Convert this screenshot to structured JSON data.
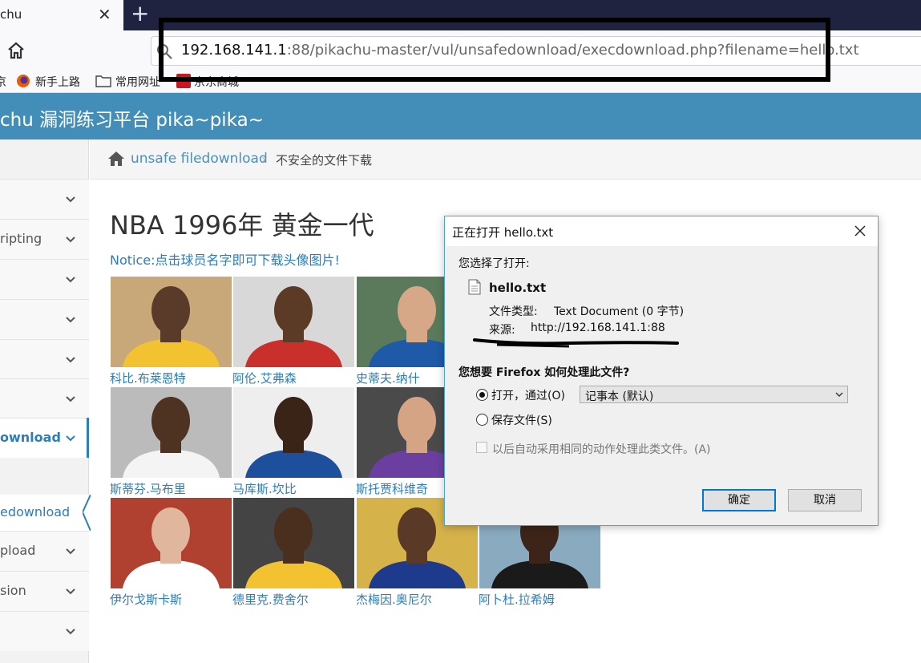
{
  "browser": {
    "tab_title": "chu",
    "tab_close": "✕",
    "new_tab": "+",
    "url_host": "192.168.141.1",
    "url_rest": ":88/pikachu-master/vul/unsafedownload/execdownload.php?filename=hello.txt",
    "bookmarks": [
      {
        "label": "京"
      },
      {
        "label": "新手上路"
      },
      {
        "label": "常用网址"
      },
      {
        "label": "京东商城"
      }
    ]
  },
  "site": {
    "title": "chu 漏洞练习平台 pika~pika~"
  },
  "sidebar": {
    "items": [
      {
        "label": ""
      },
      {
        "label": "ripting"
      },
      {
        "label": ""
      },
      {
        "label": ""
      },
      {
        "label": ""
      },
      {
        "label": ""
      }
    ],
    "active_label": "ownload",
    "sub_label": "edownload",
    "items_after": [
      {
        "label": "pload"
      },
      {
        "label": "sion"
      },
      {
        "label": ""
      }
    ]
  },
  "breadcrumb": {
    "link": "unsafe filedownload",
    "separator": "›",
    "current": "不安全的文件下载"
  },
  "content": {
    "heading": "NBA 1996年 黄金一代",
    "notice": "Notice:点击球员名字即可下载头像图片!",
    "players": [
      {
        "name": "科比.布莱恩特",
        "jersey": "#f2c230",
        "skin": "#5a3a28",
        "bg": "#c8a878"
      },
      {
        "name": "阿伦.艾弗森",
        "jersey": "#c9302c",
        "skin": "#5b3b26",
        "bg": "#d8d8d8"
      },
      {
        "name": "史蒂夫.纳什",
        "jersey": "#1e5aa8",
        "skin": "#d6a887",
        "bg": "#5b7a5b"
      },
      {
        "name": "斯蒂芬.马布里",
        "jersey": "#f4f4f4",
        "skin": "#4e3222",
        "bg": "#bbbbbb"
      },
      {
        "name": "马库斯.坎比",
        "jersey": "#1d4f9c",
        "skin": "#3a2418",
        "bg": "#eeeeee"
      },
      {
        "name": "斯托贾科维奇",
        "jersey": "#6b3fa0",
        "skin": "#d4a484",
        "bg": "#4a4a4a"
      },
      {
        "name": "伊尔戈斯卡斯",
        "jersey": "#ffffff",
        "skin": "#e0b69c",
        "bg": "#b04030"
      },
      {
        "name": "德里克.费舍尔",
        "jersey": "#f2c230",
        "skin": "#4a2e1e",
        "bg": "#444444"
      },
      {
        "name": "杰梅因.奥尼尔",
        "jersey": "#1e3a8c",
        "skin": "#5a3a26",
        "bg": "#d6b24a"
      },
      {
        "name": "阿卜杜.拉希姆",
        "jersey": "#1a1a1a",
        "skin": "#3c2418",
        "bg": "#8aaac0"
      }
    ]
  },
  "dialog": {
    "title": "正在打开 hello.txt",
    "you_chose": "您选择了打开:",
    "filename": "hello.txt",
    "filetype_label": "文件类型:",
    "filetype_value": "Text Document (0 字节)",
    "source_label": "来源:",
    "source_value": "http://192.168.141.1:88",
    "question": "您想要 Firefox 如何处理此文件?",
    "open_with_label": "打开，通过(O)",
    "open_with_app": "记事本 (默认)",
    "save_label": "保存文件(S)",
    "auto_label": "以后自动采用相同的动作处理此类文件。(A)",
    "ok_label": "确定",
    "cancel_label": "取消"
  }
}
